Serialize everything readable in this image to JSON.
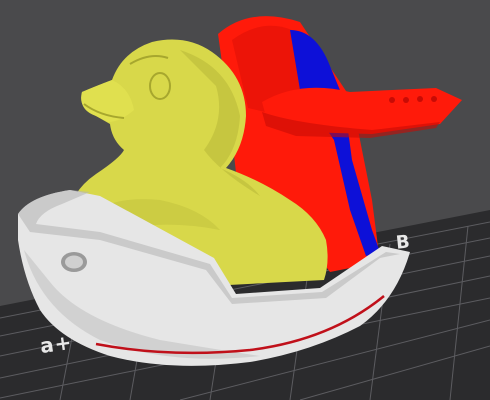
{
  "scene": {
    "view": "3d-slicer-viewport",
    "bed_labels": {
      "front_left": "a+",
      "right": "B"
    },
    "colors": {
      "background": "#4a4a4c",
      "bed": "#2b2b2d",
      "grid": "#5c5c60",
      "duck": "#d8d84a",
      "duck_shadow": "#a7a72e",
      "boat": "#e6e6e6",
      "boat_shadow": "#b8b8b8",
      "stripe": "#c0101a",
      "wing": "#ff1a0a",
      "wing_dark": "#c80b05",
      "accent": "#0d10d8"
    },
    "objects": [
      "duck",
      "boat",
      "propeller-wing"
    ]
  }
}
